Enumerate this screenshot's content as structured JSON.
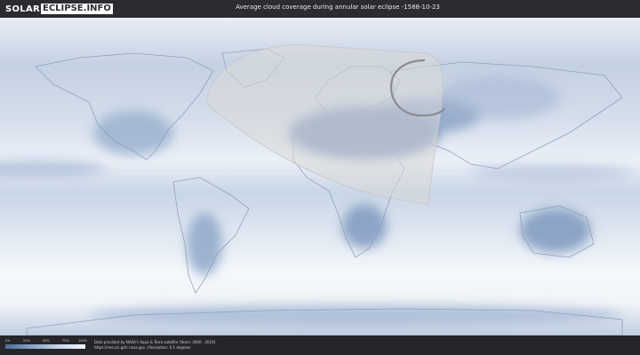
{
  "header": {
    "logo_part1": "SOLAR",
    "logo_part2": "ECLIPSE.INFO",
    "title": "Average cloud coverage during annular solar eclipse -1588-10-23"
  },
  "colors": {
    "header_bg": "#2a2c30",
    "cloud_clear": "#4e6d9c",
    "cloud_full": "#f3f6fa",
    "eclipse_shade": "#dcdcdc"
  },
  "legend": {
    "ticks": [
      "0%",
      "25%",
      "50%",
      "75%",
      "100%"
    ]
  },
  "credits": {
    "line1": "Data provided by NASA's Aqua & Terra satellite (Years: 2000 - 2019)",
    "line2": "https://neo.sci.gsfc.nasa.gov | Resolution: 0.1 degrees"
  }
}
